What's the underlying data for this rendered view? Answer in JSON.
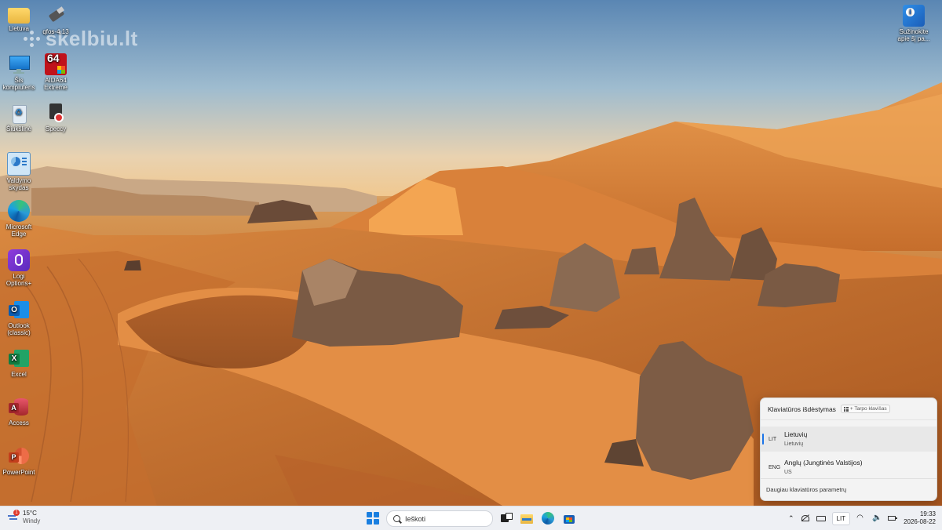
{
  "watermark": {
    "text": "skelbiu.lt"
  },
  "desktop": {
    "left_icons": [
      {
        "label": "Lietuva"
      },
      {
        "label": "qfos-4.13"
      },
      {
        "label": "Šis kompiuteris"
      },
      {
        "label": "AIDA64 Extreme"
      },
      {
        "label": "Šiukšlinė"
      },
      {
        "label": "Speccy"
      },
      {
        "label": "Valdymo skydas"
      },
      {
        "label": "Microsoft Edge"
      },
      {
        "label": "Logi Options+"
      },
      {
        "label": "Outlook (classic)"
      },
      {
        "label": "Excel"
      },
      {
        "label": "Access"
      },
      {
        "label": "PowerPoint"
      }
    ],
    "right_icon": {
      "label": "Sužinokite apie šį pa..."
    }
  },
  "keyboard_flyout": {
    "title": "Klaviatūros išdėstymas",
    "shortcut_hint": "+ Tarpo klavišas",
    "layouts": [
      {
        "code": "LIT",
        "name": "Lietuvių",
        "sub": "Lietuvių",
        "selected": true
      },
      {
        "code": "ENG",
        "name": "Anglų (Jungtinės Valstijos)",
        "sub": "US",
        "selected": false
      }
    ],
    "more_link": "Daugiau klaviatūros parametrų"
  },
  "taskbar": {
    "weather": {
      "temp": "15°C",
      "condition": "Windy",
      "badge": "1"
    },
    "search_placeholder": "Ieškoti",
    "language": "LIT",
    "time": "19:33",
    "date": "2026-08-22"
  },
  "colors": {
    "accent": "#1a73e8",
    "taskbar_bg": "#eef0f4"
  }
}
